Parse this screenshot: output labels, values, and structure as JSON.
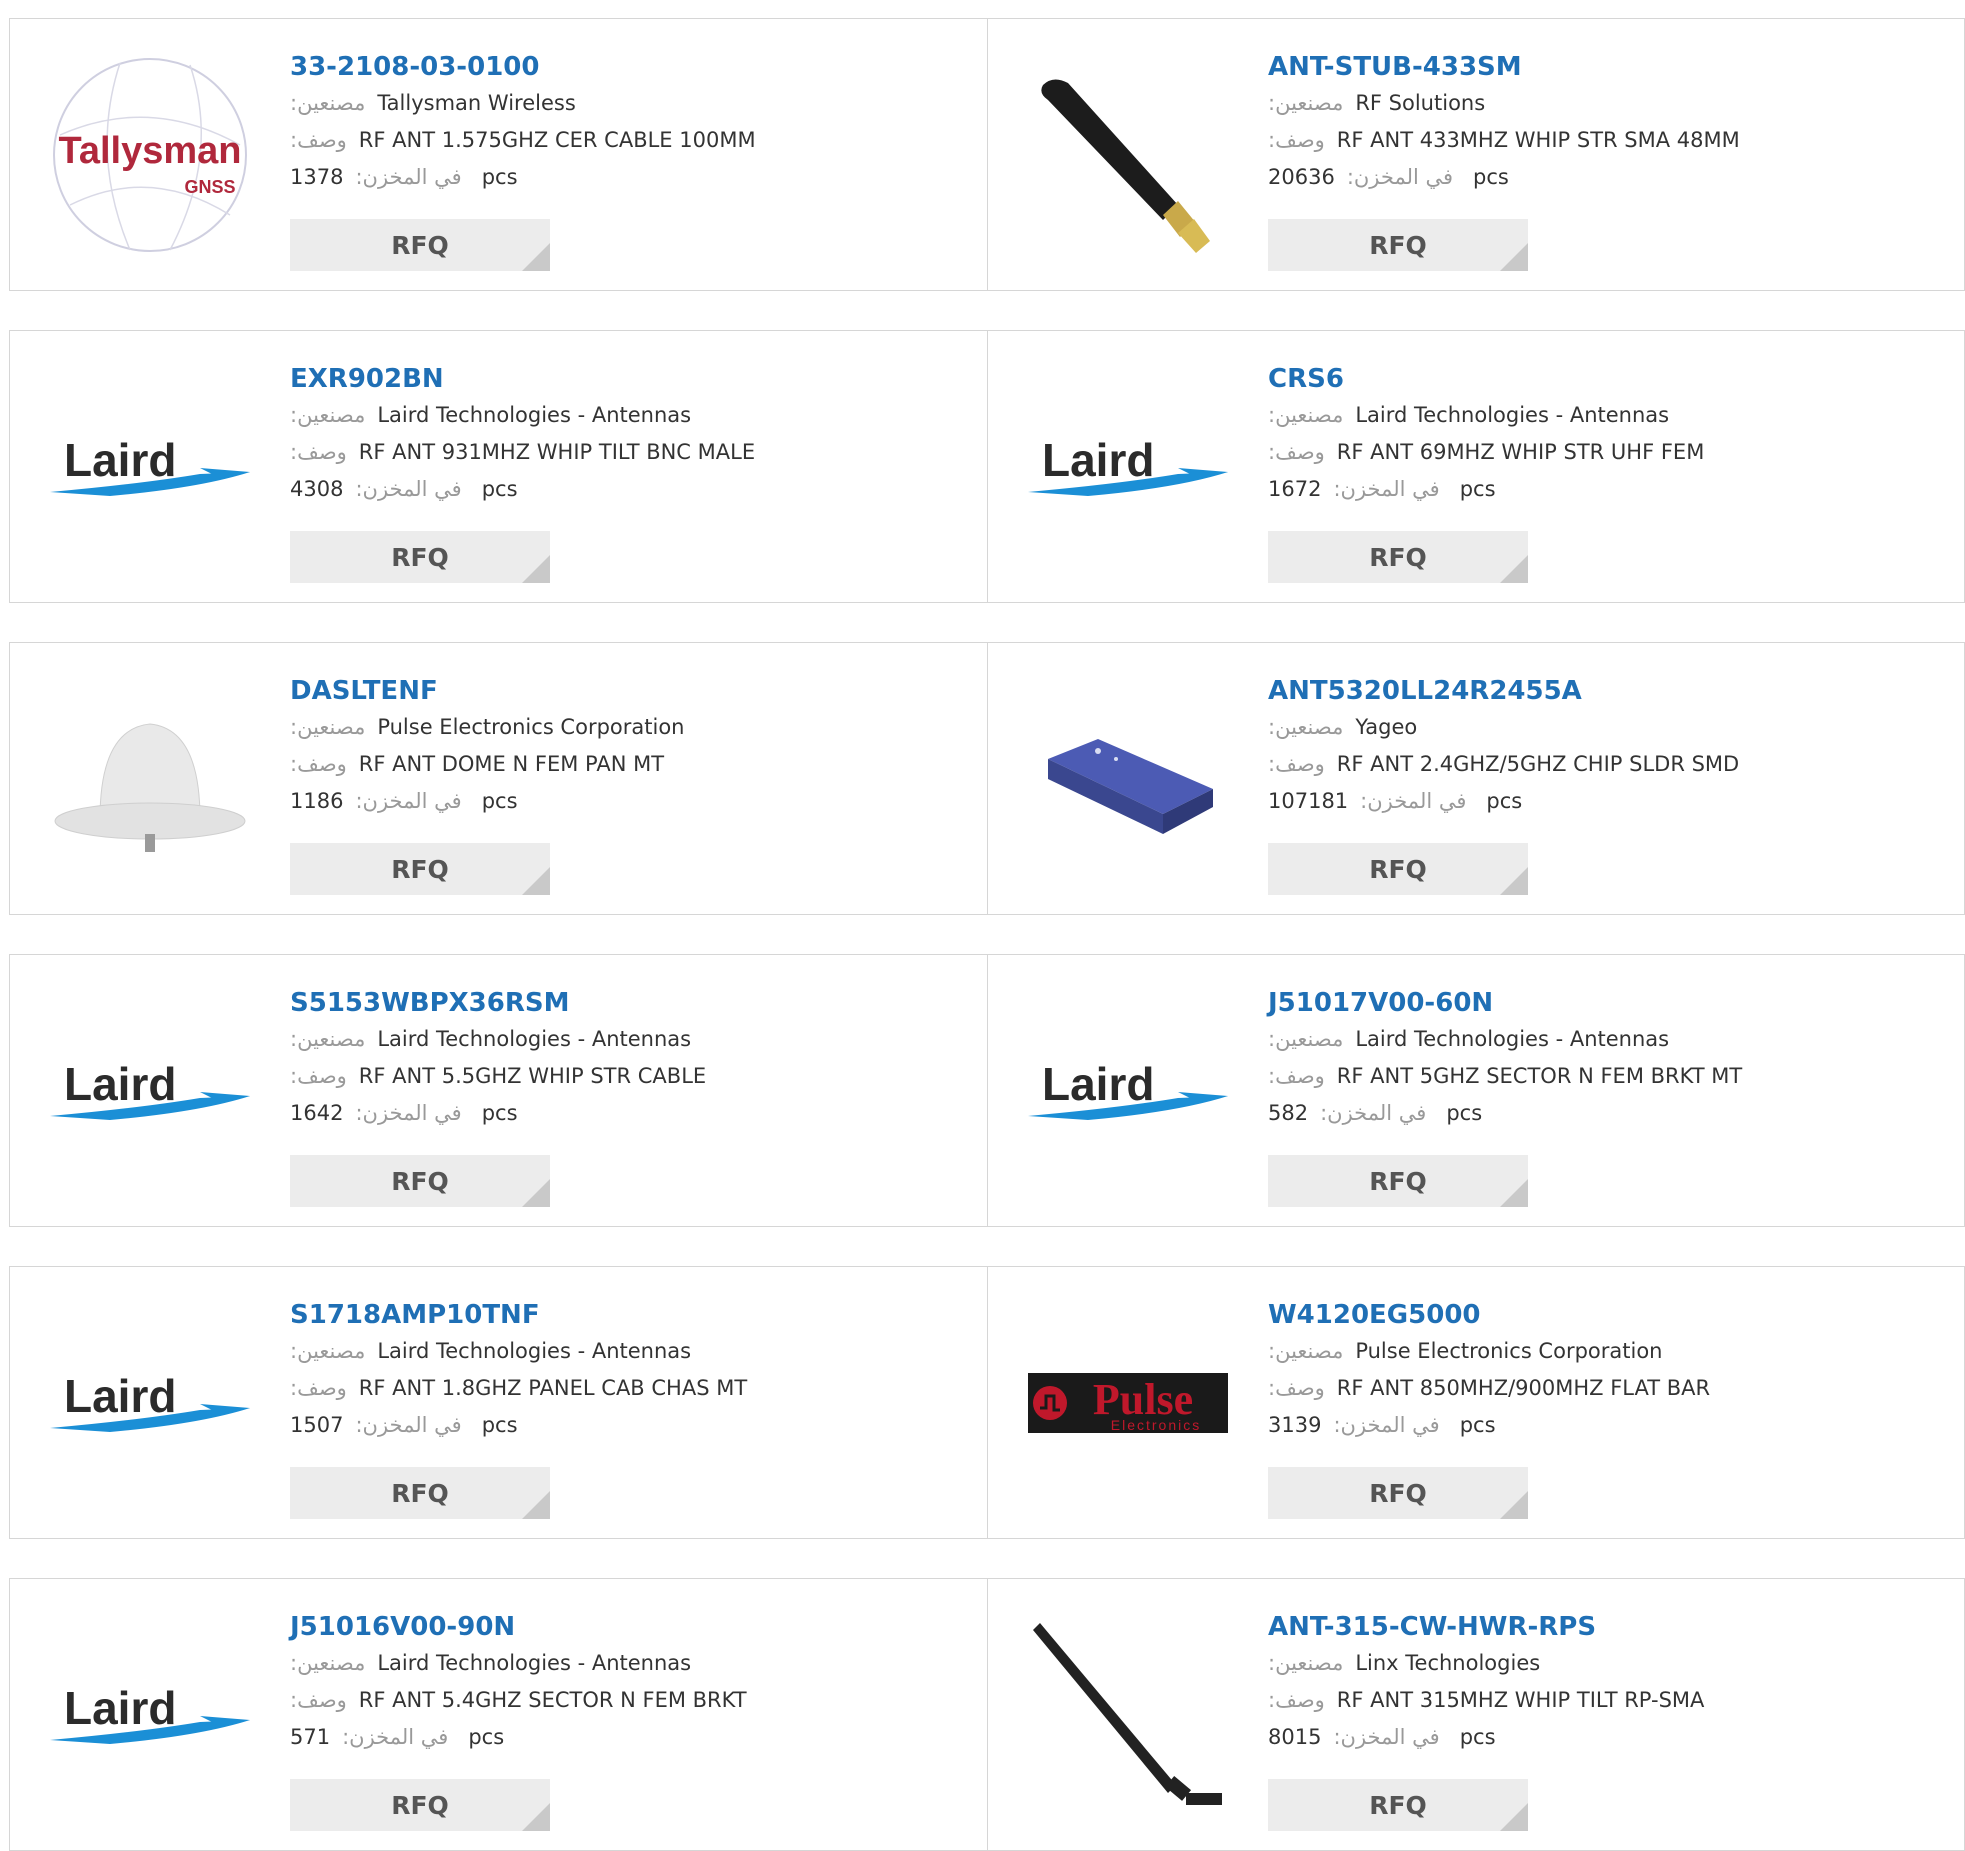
{
  "labels": {
    "manufacturer": ":مصنعين",
    "description": ":وصف",
    "in_stock": "في المخزن:",
    "unit": "pcs",
    "rfq": "RFQ"
  },
  "logo_text": {
    "tallysman": "Tallysman",
    "gnss": "GNSS",
    "laird": "Laird",
    "pulse": "Pulse",
    "electronics": "Electronics"
  },
  "products": [
    {
      "part": "33-2108-03-0100",
      "manufacturer": "Tallysman Wireless",
      "description": "RF ANT 1.575GHZ CER CABLE 100MM",
      "stock": "1378",
      "image": "tallysman-logo"
    },
    {
      "part": "ANT-STUB-433SM",
      "manufacturer": "RF Solutions",
      "description": "RF ANT 433MHZ WHIP STR SMA 48MM",
      "stock": "20636",
      "image": "stub-antenna-photo"
    },
    {
      "part": "EXR902BN",
      "manufacturer": "Laird Technologies - Antennas",
      "description": "RF ANT 931MHZ WHIP TILT BNC MALE",
      "stock": "4308",
      "image": "laird-logo"
    },
    {
      "part": "CRS6",
      "manufacturer": "Laird Technologies - Antennas",
      "description": "RF ANT 69MHZ WHIP STR UHF FEM",
      "stock": "1672",
      "image": "laird-logo"
    },
    {
      "part": "DASLTENF",
      "manufacturer": "Pulse Electronics Corporation",
      "description": "RF ANT DOME N FEM PAN MT",
      "stock": "1186",
      "image": "dome-antenna-photo"
    },
    {
      "part": "ANT5320LL24R2455A",
      "manufacturer": "Yageo",
      "description": "RF ANT 2.4GHZ/5GHZ CHIP SLDR SMD",
      "stock": "107181",
      "image": "chip-antenna-photo"
    },
    {
      "part": "S5153WBPX36RSM",
      "manufacturer": "Laird Technologies - Antennas",
      "description": "RF ANT 5.5GHZ WHIP STR CABLE",
      "stock": "1642",
      "image": "laird-logo"
    },
    {
      "part": "J51017V00-60N",
      "manufacturer": "Laird Technologies - Antennas",
      "description": "RF ANT 5GHZ SECTOR N FEM BRKT MT",
      "stock": "582",
      "image": "laird-logo"
    },
    {
      "part": "S1718AMP10TNF",
      "manufacturer": "Laird Technologies - Antennas",
      "description": "RF ANT 1.8GHZ PANEL CAB CHAS MT",
      "stock": "1507",
      "image": "laird-logo"
    },
    {
      "part": "W4120EG5000",
      "manufacturer": "Pulse Electronics Corporation",
      "description": "RF ANT 850MHZ/900MHZ FLAT BAR",
      "stock": "3139",
      "image": "pulse-logo"
    },
    {
      "part": "J51016V00-90N",
      "manufacturer": "Laird Technologies - Antennas",
      "description": "RF ANT 5.4GHZ SECTOR N FEM BRKT",
      "stock": "571",
      "image": "laird-logo"
    },
    {
      "part": "ANT-315-CW-HWR-RPS",
      "manufacturer": "Linx Technologies",
      "description": "RF ANT 315MHZ WHIP TILT RP-SMA",
      "stock": "8015",
      "image": "whip-antenna-photo"
    }
  ]
}
